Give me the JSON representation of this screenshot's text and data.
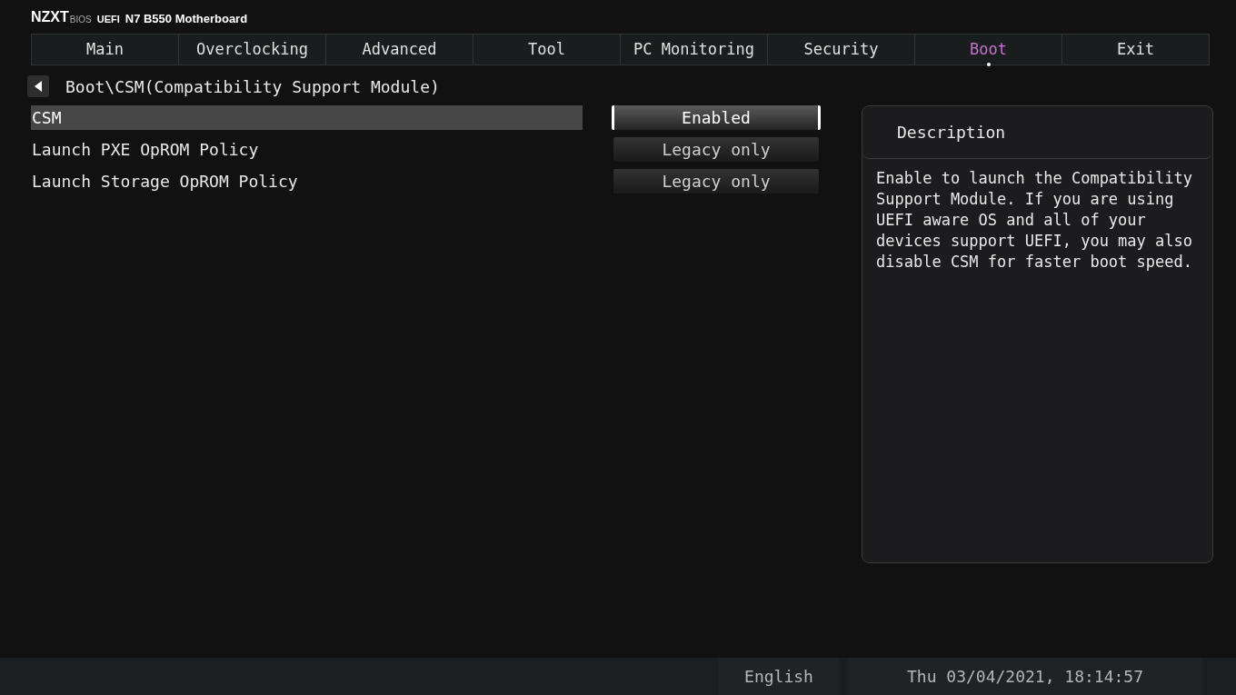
{
  "header": {
    "brand": "NZXT",
    "suffix": "BIOS",
    "firmware": "UEFI",
    "model": "N7 B550 Motherboard"
  },
  "tabs": [
    {
      "label": "Main",
      "selected": false
    },
    {
      "label": "Overclocking",
      "selected": false
    },
    {
      "label": "Advanced",
      "selected": false
    },
    {
      "label": "Tool",
      "selected": false
    },
    {
      "label": "PC Monitoring",
      "selected": false
    },
    {
      "label": "Security",
      "selected": false
    },
    {
      "label": "Boot",
      "selected": true
    },
    {
      "label": "Exit",
      "selected": false
    }
  ],
  "breadcrumb": "Boot\\CSM(Compatibility Support Module)",
  "settings": [
    {
      "label": "CSM",
      "value": "Enabled",
      "selected": true
    },
    {
      "label": "Launch PXE OpROM Policy",
      "value": "Legacy only",
      "selected": false
    },
    {
      "label": "Launch Storage OpROM Policy",
      "value": "Legacy only",
      "selected": false
    }
  ],
  "description": {
    "title": "Description",
    "text": "Enable to launch the Compatibility Support Module. If you are using UEFI aware OS and all of your devices support UEFI, you may also disable CSM for faster boot speed."
  },
  "status_bar": {
    "language": "English",
    "datetime": "Thu 03/04/2021, 18:14:57"
  }
}
